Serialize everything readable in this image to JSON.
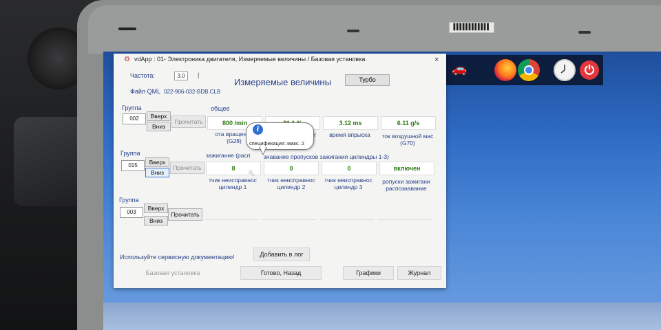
{
  "window": {
    "title": "vdApp : 01- Электроника двигателя,  Измеряемые величины / Базовая установка",
    "close": "×"
  },
  "header": {
    "freq_label": "Частота:",
    "freq_value": "3.0",
    "heading": "Измеряемые величины",
    "turbo_label": "Турбо",
    "file_label": "Файл QML",
    "file_value": "022-906-032-BDB.CLB"
  },
  "general_label": "общее",
  "groups": [
    {
      "label": "Группа",
      "number": "002",
      "up": "Вверх",
      "down": "Вниз",
      "read": "Прочитать",
      "values": [
        "800 /min",
        "21.1 %",
        "3.12 ms",
        "6.11 g/s"
      ],
      "captions": [
        "ота вращения\n(G28)",
        "er",
        "время впрыска",
        "ток воздушной мас\n(G70)"
      ]
    },
    {
      "label": "Группа",
      "number": "015",
      "up": "Вверх",
      "down": "Вниз",
      "read": "Прочитать",
      "header_text": "зажигание (расп",
      "header_text2": "знавание пропусков зажигания цилиндры 1-3)",
      "values": [
        "8",
        "0",
        "0",
        "включен"
      ],
      "captions": [
        "тчик неисправнос\nцилиндр 1",
        "тчик неисправнос\nцилиндр 2",
        "тчик неисправнос\nцилиндр 3",
        "ропуски зажигани\nраспознавание"
      ]
    },
    {
      "label": "Группа",
      "number": "003",
      "up": "Вверх",
      "down": "Вниз",
      "read": "Прочитать"
    }
  ],
  "tooltip": {
    "icon": "info-icon",
    "icon_glyph": "i",
    "text": "спецификация: макс. 2"
  },
  "footer": {
    "service_text": "Используйте сервисную документацию!",
    "add_log": "Добавить в лог",
    "basic_setting": "Базовая установка",
    "done_back": "Готово, Назад",
    "graphs": "Графики",
    "journal": "Журнал"
  },
  "photo": {
    "sticker_text": "▌▌▌▌▌▌▌▌▌▌▌▌"
  },
  "taskbar": {
    "icons": [
      "car-icon",
      "firefox-icon",
      "chrome-icon",
      "clock-icon",
      "power-icon"
    ],
    "car_glyph": "🚗",
    "power_glyph": "⏻"
  },
  "colors": {
    "label_blue": "#26408b",
    "value_green": "#2d7a10",
    "desktop_blue": "#2e6bc4"
  }
}
